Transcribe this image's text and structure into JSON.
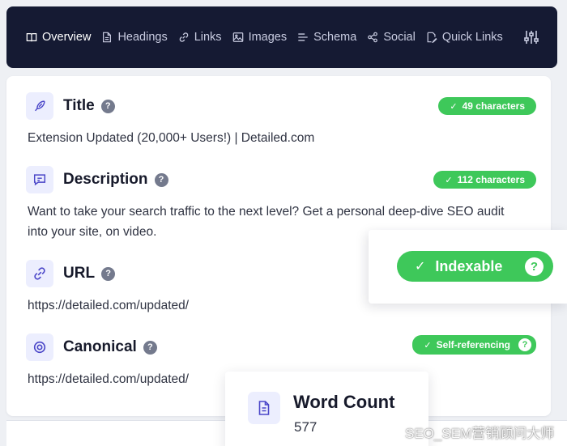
{
  "nav": {
    "items": [
      {
        "label": "Overview",
        "icon": "book-icon"
      },
      {
        "label": "Headings",
        "icon": "document-icon"
      },
      {
        "label": "Links",
        "icon": "link-icon"
      },
      {
        "label": "Images",
        "icon": "image-icon"
      },
      {
        "label": "Schema",
        "icon": "list-icon"
      },
      {
        "label": "Social",
        "icon": "share-icon"
      },
      {
        "label": "Quick Links",
        "icon": "pencil-doc-icon"
      }
    ],
    "tools_icon": "sliders-icon"
  },
  "sections": {
    "title": {
      "heading": "Title",
      "badge": "49 characters",
      "text": "Extension Updated (20,000+ Users!) | Detailed.com"
    },
    "description": {
      "heading": "Description",
      "badge": "112 characters",
      "text": "Want to take your search traffic to the next level? Get a personal deep-dive SEO audit into your site, on video."
    },
    "url": {
      "heading": "URL",
      "text": "https://detailed.com/updated/"
    },
    "canonical": {
      "heading": "Canonical",
      "badge": "Self-referencing",
      "text": "https://detailed.com/updated/"
    }
  },
  "indexable": {
    "label": "Indexable"
  },
  "word_count": {
    "label": "Word Count",
    "value": "577"
  },
  "watermark": "SEO_SEM营销顾问大师",
  "colors": {
    "nav_bg": "#151a33",
    "accent": "#4a46c8",
    "success": "#3ec85a",
    "icon_bg": "#eceefe"
  }
}
